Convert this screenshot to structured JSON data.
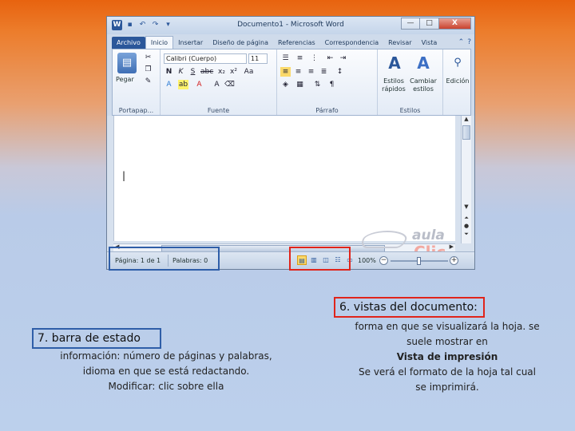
{
  "window": {
    "title": "Documento1 - Microsoft Word",
    "word_logo": "W",
    "controls": [
      "—",
      "□",
      "X"
    ]
  },
  "tabs": [
    {
      "label": "Archivo"
    },
    {
      "label": "Inicio"
    },
    {
      "label": "Insertar"
    },
    {
      "label": "Diseño de página"
    },
    {
      "label": "Referencias"
    },
    {
      "label": "Correspondencia"
    },
    {
      "label": "Revisar"
    },
    {
      "label": "Vista"
    }
  ],
  "ribbon": {
    "clipboard": {
      "paste_label": "Pegar",
      "group_label": "Portapap..."
    },
    "font": {
      "font_name": "Calibri (Cuerpo)",
      "font_size": "11",
      "group_label": "Fuente"
    },
    "paragraph": {
      "group_label": "Párrafo"
    },
    "styles": {
      "quick_styles": "Estilos rápidos",
      "change_styles": "Cambiar estilos",
      "group_label": "Estilos"
    },
    "editing": {
      "label": "Edición"
    }
  },
  "statusbar": {
    "page": "Página: 1 de 1",
    "words": "Palabras: 0",
    "zoom": "100%",
    "zoom_minus": "−",
    "zoom_plus": "+"
  },
  "watermark": {
    "line1": "aula",
    "line2": "Clic"
  },
  "captions": {
    "views": {
      "title": "6. vistas del documento:",
      "line1": "forma en que se visualizará la hoja. se",
      "line2": "suele mostrar en",
      "line3": "Vista de impresión",
      "line4": "Se verá el formato de la hoja tal cual",
      "line5": "se imprimirá."
    },
    "statusbar": {
      "title": "7. barra de estado",
      "line1": "información: número de páginas y palabras,",
      "line2": "idioma en que se está redactando.",
      "line3": "Modificar: clic sobre ella"
    }
  },
  "colors": {
    "accent": "#2b579a",
    "highlight_red": "#e0241b",
    "highlight_blue": "#2f5ea8"
  }
}
